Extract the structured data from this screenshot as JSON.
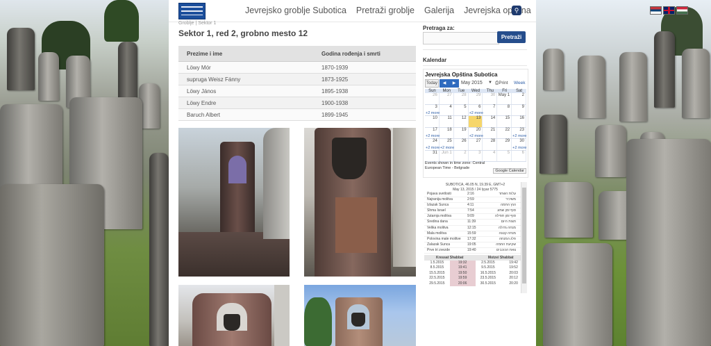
{
  "nav": {
    "logo_icon": "community-logo-icon",
    "links": [
      "Jevrejsko groblje Subotica",
      "Pretraži groblje",
      "Galerija",
      "Jevrejska opština"
    ],
    "search_icon": "magnifier-icon"
  },
  "languages": [
    {
      "name": "srpski",
      "icon": "serbia-flag-icon"
    },
    {
      "name": "english",
      "icon": "uk-flag-icon"
    },
    {
      "name": "magyar",
      "icon": "hungary-flag-icon"
    }
  ],
  "breadcrumb": "Groblje | Sektor 1",
  "page_title": "Sektor 1, red 2, grobno mesto 12",
  "graves_table": {
    "headers": [
      "Prezime i ime",
      "Godina rođenja i smrti"
    ],
    "rows": [
      [
        "Löwy Mór",
        "1870-1939"
      ],
      [
        "supruga Weisz Fánny",
        "1873-1925"
      ],
      [
        "Löwy János",
        "1895-1938"
      ],
      [
        "Löwy Endre",
        "1900-1938"
      ],
      [
        "Baruch Albert",
        "1899-1945"
      ]
    ]
  },
  "photos": [
    {
      "icon": "gravestone-photo"
    },
    {
      "icon": "gravestone-urn-photo"
    },
    {
      "icon": "gravestone-photo"
    },
    {
      "icon": "gravestone-photo"
    }
  ],
  "search": {
    "label": "Pretraga za:",
    "value": "",
    "button": "Pretraži"
  },
  "calendar": {
    "section_title": "Kalendar",
    "widget_title": "Jevrejska Opština Subotica",
    "today_button": "Today",
    "month": "May 2015",
    "print": "Print",
    "view": "Week",
    "days_of_week": [
      "Sun",
      "Mon",
      "Tue",
      "Wed",
      "Thu",
      "Fri",
      "Sat"
    ],
    "weeks": [
      [
        {
          "d": "26",
          "dim": true
        },
        {
          "d": "27",
          "dim": true
        },
        {
          "d": "28",
          "dim": true
        },
        {
          "d": "29",
          "dim": true
        },
        {
          "d": "30",
          "dim": true
        },
        {
          "d": "May 1"
        },
        {
          "d": "2"
        }
      ],
      [
        {
          "d": "3",
          "more": "+2 more"
        },
        {
          "d": "4"
        },
        {
          "d": "5"
        },
        {
          "d": "6",
          "more": "+2 more"
        },
        {
          "d": "7"
        },
        {
          "d": "8"
        },
        {
          "d": "9"
        }
      ],
      [
        {
          "d": "10"
        },
        {
          "d": "11"
        },
        {
          "d": "12"
        },
        {
          "d": "13",
          "today": true
        },
        {
          "d": "14"
        },
        {
          "d": "15"
        },
        {
          "d": "16"
        }
      ],
      [
        {
          "d": "17",
          "more": "+2 more"
        },
        {
          "d": "18"
        },
        {
          "d": "19"
        },
        {
          "d": "20",
          "more": "+2 more"
        },
        {
          "d": "21"
        },
        {
          "d": "22"
        },
        {
          "d": "23",
          "more": "+2 more"
        }
      ],
      [
        {
          "d": "24",
          "more": "+2 more"
        },
        {
          "d": "25",
          "more": "+2 more"
        },
        {
          "d": "26"
        },
        {
          "d": "27"
        },
        {
          "d": "28"
        },
        {
          "d": "29"
        },
        {
          "d": "30",
          "more": "+2 more"
        }
      ],
      [
        {
          "d": "31"
        },
        {
          "d": "Jun 1",
          "dim": true
        },
        {
          "d": "2",
          "dim": true
        },
        {
          "d": "3",
          "dim": true
        },
        {
          "d": "4",
          "dim": true
        },
        {
          "d": "5",
          "dim": true
        },
        {
          "d": "6",
          "dim": true
        }
      ]
    ],
    "timezone_note": "Events shown in time zone: Central European Time - Belgrade",
    "google_button": "Google Calendar"
  },
  "zmanim": {
    "location": "SUBOTICA, 46.05 N, 19.39 E, GMT+2",
    "date": "May 13, 2015 / 24 Iyyar 5775",
    "rows": [
      [
        "Pojava svetlosti",
        "2:16",
        "עלות השחר"
      ],
      [
        "Najranija molitva",
        "2:59",
        "משיכיר"
      ],
      [
        "Izlazak Sunca",
        "4:11",
        "הנץ החמה"
      ],
      [
        "Shma Israel",
        "7:54",
        "סוף זמן שמע"
      ],
      [
        "Jutarnja molitva",
        "9:09",
        "סוף זמן תפילה"
      ],
      [
        "Sredina dana",
        "11:39",
        "חצות היום"
      ],
      [
        "Velika molitva",
        "12:15",
        "מנחה גדולה"
      ],
      [
        "Mala molitva",
        "15:59",
        "מנחה קטנה"
      ],
      [
        "Polovina male molitve",
        "17:32",
        "פלג המנחה"
      ],
      [
        "Zalazak Sunca",
        "19:05",
        "שקיעת החמה"
      ],
      [
        "Prve tri zvezde",
        "19:40",
        "צאת הכוכבים"
      ]
    ],
    "shabbat_headers": [
      "Kressat Shabbat",
      "Motzei Shabbat"
    ],
    "shabbat_rows": [
      [
        "1.5.2015",
        "19:32",
        "2.5.2015",
        "19:42"
      ],
      [
        "8.5.2015",
        "19:41",
        "9.5.2015",
        "19:52"
      ],
      [
        "15.5.2015",
        "19:50",
        "16.5.2015",
        "20:03"
      ],
      [
        "22.5.2015",
        "19:59",
        "23.5.2015",
        "20:12"
      ],
      [
        "29.5.2015",
        "20:06",
        "30.5.2015",
        "20:20"
      ]
    ]
  }
}
